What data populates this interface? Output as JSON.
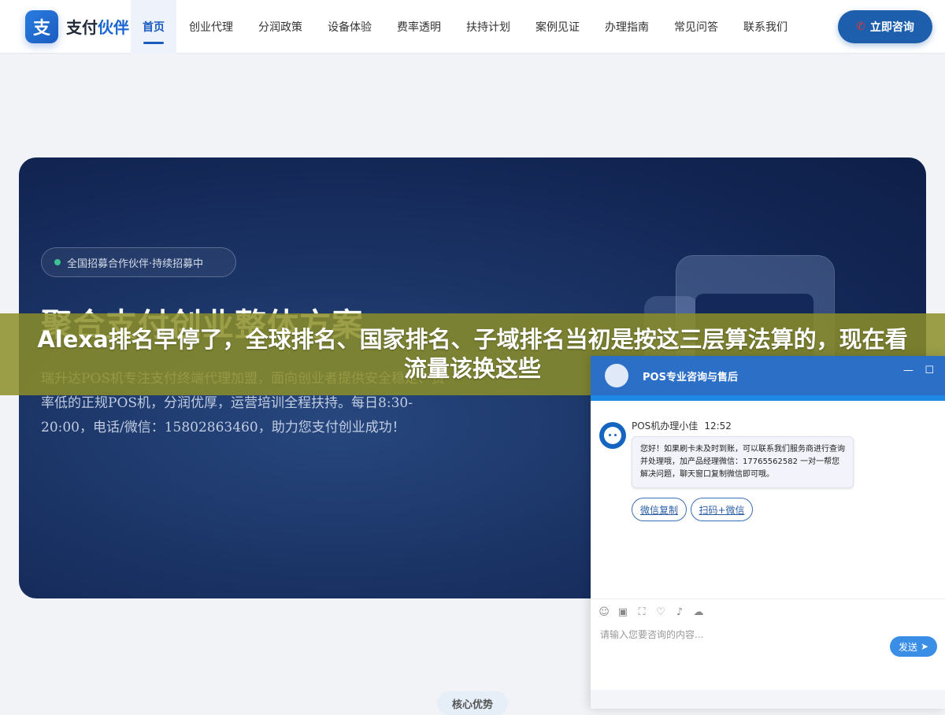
{
  "logo": {
    "mark": "支",
    "name_plain": "支付",
    "name_accent": "伙伴"
  },
  "nav": {
    "items": [
      {
        "label": "首页"
      },
      {
        "label": "创业代理"
      },
      {
        "label": "分润政策"
      },
      {
        "label": "设备体验"
      },
      {
        "label": "费率透明"
      },
      {
        "label": "扶持计划"
      },
      {
        "label": "案例见证"
      },
      {
        "label": "办理指南"
      },
      {
        "label": "常见问答"
      },
      {
        "label": "联系我们"
      }
    ],
    "active_index": 0,
    "cta_label": "立即咨询",
    "cta_icon": "phone-icon"
  },
  "hero": {
    "badge": "全国招募合作伙伴·持续招募中",
    "title": "聚合支付创业整体方案",
    "description": "瑞升达POS机专注支付终端代理加盟，面向创业者提供安全稳定、费率低的正规POS机，分润优厚，运营培训全程扶持。每日8:30-20:00，电话/微信：15802863460，助力您支付创业成功！"
  },
  "banner": {
    "text": "Alexa排名早停了，全球排名、国家排名、子域排名当初是按这三层算法算的，现在看流量该换这些"
  },
  "chat": {
    "title": "POS专业咨询与售后",
    "minimize_icon": "—",
    "maximize_icon": "☐",
    "agent_name": "POS机办理小佳",
    "time": "12:52",
    "message": "您好！如果刷卡未及时到账，可以联系我们服务商进行查询并处理哦，加产品经理微信：17765562582 一对一帮您解决问题，聊天窗口复制微信即可哦。",
    "chip_copy": "微信复制",
    "chip_scan": "扫码+微信",
    "input_placeholder": "请输入您要咨询的内容...",
    "send_label": "发送",
    "tool_icons": [
      "☺",
      "▣",
      "⛶",
      "♡",
      "♪",
      "☁"
    ]
  },
  "section": {
    "tag": "核心优势"
  },
  "colors": {
    "brand": "#1a5bbf",
    "cta": "#1e5fad",
    "banner": "#8c8e28",
    "chat_header": "#2c6fc7"
  }
}
